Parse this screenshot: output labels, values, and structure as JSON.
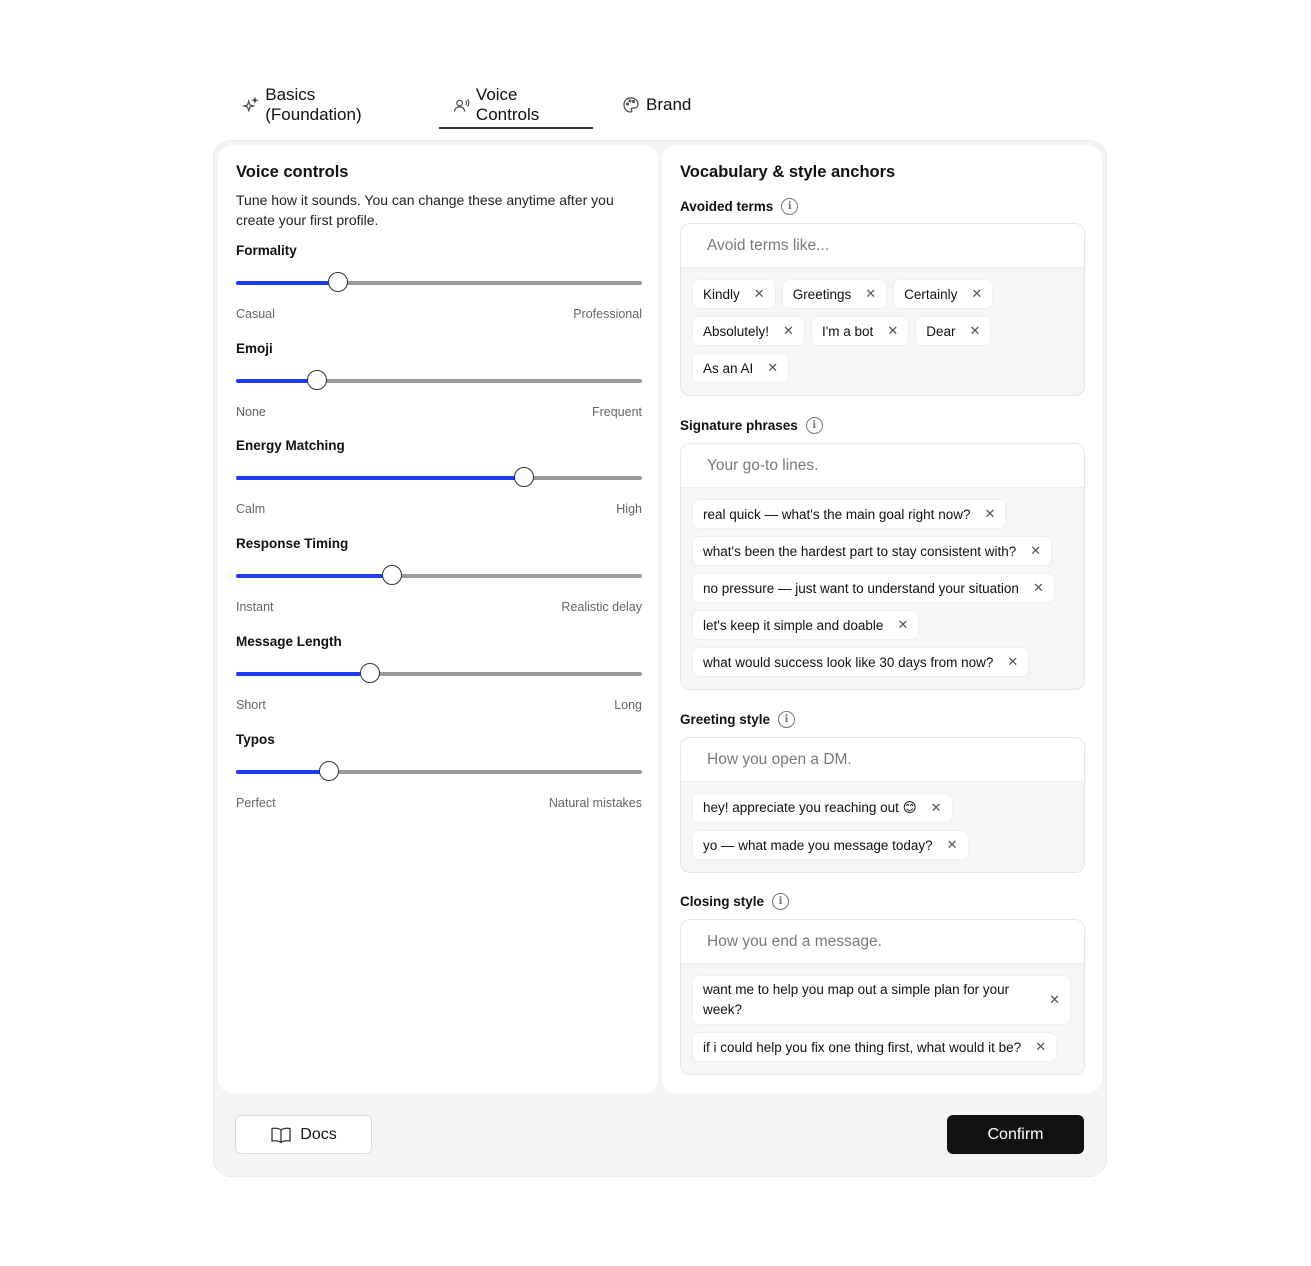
{
  "tabs": [
    {
      "label": "Basics (Foundation)",
      "icon": "sparkle-icon",
      "active": false
    },
    {
      "label": "Voice Controls",
      "icon": "voice-user-icon",
      "active": true
    },
    {
      "label": "Brand",
      "icon": "palette-icon",
      "active": false
    }
  ],
  "voice_controls": {
    "title": "Voice controls",
    "description": "Tune how it sounds. You can change these anytime after you create your first profile.",
    "sliders": [
      {
        "label": "Formality",
        "min_label": "Casual",
        "max_label": "Professional",
        "value": 0.25
      },
      {
        "label": "Emoji",
        "min_label": "None",
        "max_label": "Frequent",
        "value": 0.2
      },
      {
        "label": "Energy Matching",
        "min_label": "Calm",
        "max_label": "High",
        "value": 0.71
      },
      {
        "label": "Response Timing",
        "min_label": "Instant",
        "max_label": "Realistic delay",
        "value": 0.385
      },
      {
        "label": "Message Length",
        "min_label": "Short",
        "max_label": "Long",
        "value": 0.33
      },
      {
        "label": "Typos",
        "min_label": "Perfect",
        "max_label": "Natural mistakes",
        "value": 0.23
      }
    ]
  },
  "vocabulary": {
    "title": "Vocabulary & style anchors",
    "avoided_terms": {
      "label": "Avoided terms",
      "placeholder": "Avoid terms like...",
      "chips": [
        "Kindly",
        "Greetings",
        "Certainly",
        "Absolutely!",
        "I'm a bot",
        "Dear",
        "As an AI"
      ]
    },
    "signature_phrases": {
      "label": "Signature phrases",
      "placeholder": "Your go-to lines.",
      "chips": [
        "real quick — what's the main goal right now?",
        "what's been the hardest part to stay consistent with?",
        "no pressure — just want to understand your situation",
        "let's keep it simple and doable",
        "what would success look like 30 days from now?"
      ]
    },
    "greeting_style": {
      "label": "Greeting style",
      "placeholder": "How you open a DM.",
      "chips": [
        "hey! appreciate you reaching out 😊",
        "yo — what made you message today?"
      ]
    },
    "closing_style": {
      "label": "Closing style",
      "placeholder": "How you end a message.",
      "chips": [
        "want me to help you map out a simple plan for your week?",
        "if i could help you fix one thing first, what would it be?"
      ]
    }
  },
  "footer": {
    "docs_label": "Docs",
    "confirm_label": "Confirm"
  },
  "colors": {
    "accent": "#1f3cf2",
    "confirm_bg": "#111111"
  }
}
